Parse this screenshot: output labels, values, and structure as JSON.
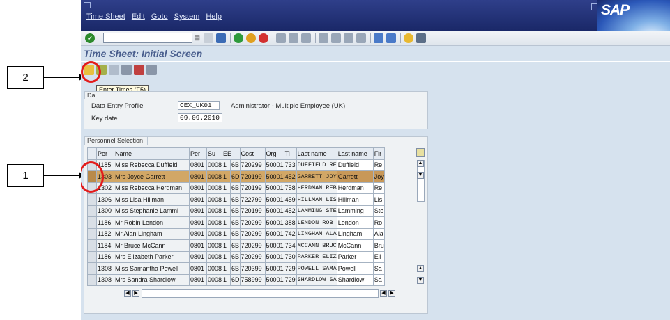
{
  "callouts": [
    {
      "label": "1"
    },
    {
      "label": "2"
    }
  ],
  "menu": [
    "Time Sheet",
    "Edit",
    "Goto",
    "System",
    "Help"
  ],
  "logo_text": "SAP",
  "screen_title": "Time Sheet: Initial Screen",
  "tooltip": "Enter Times   (F5)",
  "data_entry": {
    "tab_label": "Da",
    "profile_label": "Data Entry Profile",
    "profile_value": "CEX_UK01",
    "profile_desc": "Administrator - Multiple Employee (UK)",
    "keydate_label": "Key date",
    "keydate_value": "09.09.2010"
  },
  "personnel": {
    "tab_label": "Personnel Selection",
    "columns": [
      "Per",
      "Name",
      "Per",
      "Su",
      "EE",
      "Cost",
      "Org",
      "Ti",
      "Last name",
      "Last name",
      "Fir"
    ],
    "rows": [
      [
        "1185",
        "Miss Rebecca Duffield",
        "0801",
        "0008",
        "1",
        "6B",
        "720299",
        "50001",
        "733",
        "DUFFIELD  RE",
        "Duffield",
        "Re"
      ],
      [
        "1303",
        "Mrs Joyce Garrett",
        "0801",
        "0008",
        "1",
        "6D",
        "720199",
        "50001",
        "452",
        "GARRETT  JOY",
        "Garrett",
        "Joy"
      ],
      [
        "1302",
        "Miss Rebecca Herdman",
        "0801",
        "0008",
        "1",
        "6B",
        "720199",
        "50001",
        "758",
        "HERDMAN  REB",
        "Herdman",
        "Re"
      ],
      [
        "1306",
        "Miss Lisa Hillman",
        "0801",
        "0008",
        "1",
        "6B",
        "722799",
        "50001",
        "459",
        "HILLMAN  LIS",
        "Hillman",
        "Lis"
      ],
      [
        "1300",
        "Miss Stephanie Lammi",
        "0801",
        "0008",
        "1",
        "6B",
        "720199",
        "50001",
        "452",
        "LAMMING  STE",
        "Lamming",
        "Ste"
      ],
      [
        "1186",
        "Mr Robin Lendon",
        "0801",
        "0008",
        "1",
        "6B",
        "720299",
        "50001",
        "388",
        "LENDON  ROB",
        "Lendon",
        "Ro"
      ],
      [
        "1182",
        "Mr Alan Lingham",
        "0801",
        "0008",
        "1",
        "6B",
        "720299",
        "50001",
        "742",
        "LINGHAM  ALA",
        "Lingham",
        "Ala"
      ],
      [
        "1184",
        "Mr Bruce McCann",
        "0801",
        "0008",
        "1",
        "6B",
        "720299",
        "50001",
        "734",
        "MCCANN  BRUC",
        "McCann",
        "Bru"
      ],
      [
        "1186",
        "Mrs Elizabeth Parker",
        "0801",
        "0008",
        "1",
        "6B",
        "720299",
        "50001",
        "730",
        "PARKER  ELIZ",
        "Parker",
        "Eli"
      ],
      [
        "1308",
        "Miss Samantha Powell",
        "0801",
        "0008",
        "1",
        "6B",
        "720399",
        "50001",
        "729",
        "POWELL  SAMA",
        "Powell",
        "Sa"
      ],
      [
        "1308",
        "Mrs Sandra Shardlow",
        "0801",
        "0008",
        "1",
        "6D",
        "758999",
        "50001",
        "729",
        "SHARDLOW  SA",
        "Shardlow",
        "Sa"
      ]
    ]
  }
}
